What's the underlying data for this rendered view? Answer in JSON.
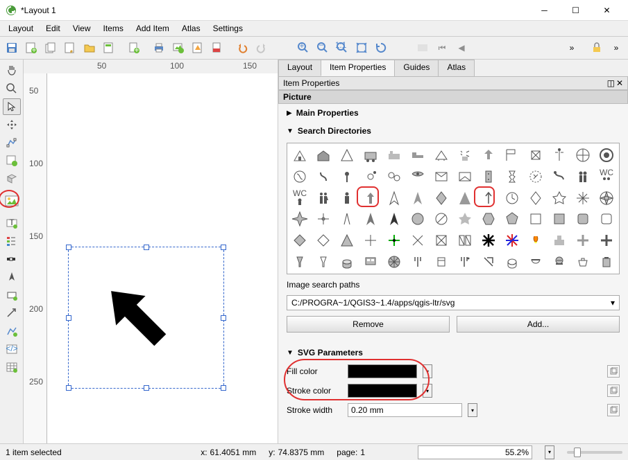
{
  "title": "*Layout 1",
  "menu": [
    "Layout",
    "Edit",
    "View",
    "Items",
    "Add Item",
    "Atlas",
    "Settings"
  ],
  "ruler_h": [
    "50",
    "100",
    "150"
  ],
  "ruler_v": [
    "50",
    "100",
    "150",
    "200",
    "250"
  ],
  "tabs": [
    "Layout",
    "Item Properties",
    "Guides",
    "Atlas"
  ],
  "active_tab": 1,
  "panel_title": "Item Properties",
  "section_title": "Picture",
  "sections": {
    "main_props": "Main Properties",
    "search_dirs": "Search Directories",
    "svg_params": "SVG Parameters",
    "search_paths_label": "Image search paths"
  },
  "search_path": "C:/PROGRA~1/QGIS3~1.4/apps/qgis-ltr/svg",
  "remove_btn": "Remove",
  "add_btn": "Add...",
  "svg_params": {
    "fill_label": "Fill color",
    "stroke_label": "Stroke color",
    "width_label": "Stroke width",
    "width_value": "0.20 mm"
  },
  "status": {
    "selection": "1 item selected",
    "x_label": "x:",
    "x_value": "61.4051 mm",
    "y_label": "y:",
    "y_value": "74.8375 mm",
    "page_label": "page:",
    "page_value": "1",
    "zoom": "55.2%"
  }
}
